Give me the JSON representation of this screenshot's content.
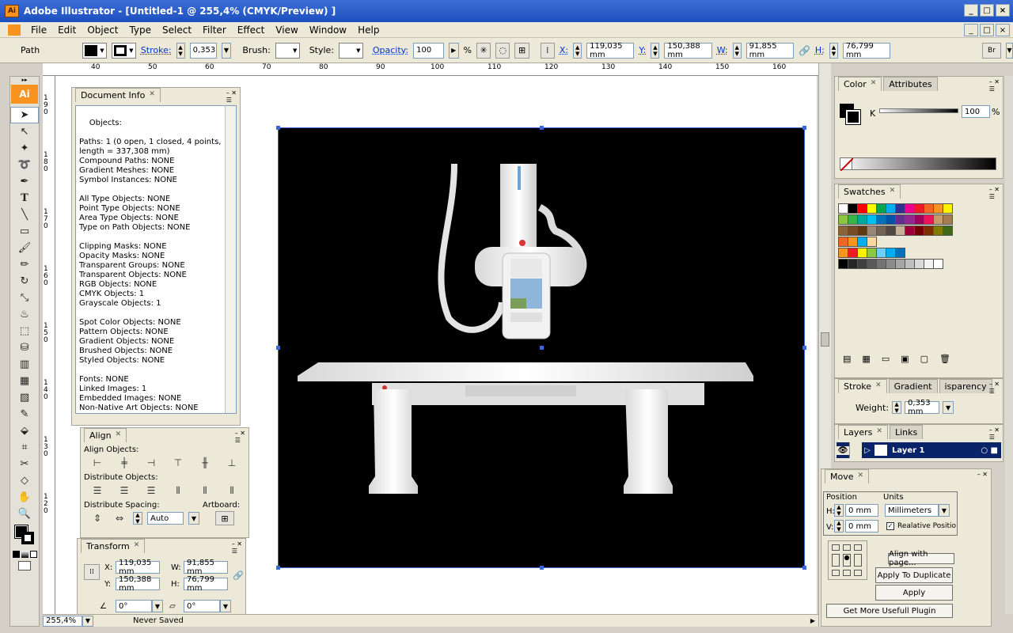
{
  "window": {
    "app_badge": "Ai",
    "title": "Adobe Illustrator - [Untitled-1 @ 255,4% (CMYK/Preview) ]",
    "min": "_",
    "max": "□",
    "close": "×"
  },
  "menu": [
    "File",
    "Edit",
    "Object",
    "Type",
    "Select",
    "Filter",
    "Effect",
    "View",
    "Window",
    "Help"
  ],
  "control": {
    "selection": "Path",
    "stroke_label": "Stroke:",
    "stroke_value": "0,353",
    "brush_label": "Brush:",
    "style_label": "Style:",
    "opacity_label": "Opacity:",
    "opacity_value": "100",
    "opacity_unit": "%",
    "x_label": "X:",
    "x_value": "119,035 mm",
    "y_label": "Y:",
    "y_value": "150,388 mm",
    "w_label": "W:",
    "w_value": "91,855 mm",
    "h_label": "H:",
    "h_value": "76,799 mm",
    "br_label": "Br"
  },
  "ruler": {
    "h_ticks": [
      "40",
      "50",
      "60",
      "70",
      "80",
      "90",
      "100",
      "110",
      "120",
      "130",
      "140",
      "150",
      "160"
    ],
    "v_ticks": [
      "1\n9\n0",
      "1\n8\n0",
      "1\n7\n0",
      "1\n6\n0",
      "1\n5\n0",
      "1\n4\n0",
      "1\n3\n0",
      "1\n2\n0"
    ]
  },
  "document_info": {
    "tab": "Document Info",
    "body": "Objects:\n\nPaths: 1 (0 open, 1 closed, 4 points,\nlength = 337,308 mm)\nCompound Paths: NONE\nGradient Meshes: NONE\nSymbol Instances: NONE\n\nAll Type Objects: NONE\nPoint Type Objects: NONE\nArea Type Objects: NONE\nType on Path Objects: NONE\n\nClipping Masks: NONE\nOpacity Masks: NONE\nTransparent Groups: NONE\nTransparent Objects: NONE\nRGB Objects: NONE\nCMYK Objects: 1\nGrayscale Objects: 1\n\nSpot Color Objects: NONE\nPattern Objects: NONE\nGradient Objects: NONE\nBrushed Objects: NONE\nStyled Objects: NONE\n\nFonts: NONE\nLinked Images: 1\nEmbedded Images: NONE\nNon-Native Art Objects: NONE"
  },
  "align": {
    "tab": "Align",
    "align_objects": "Align Objects:",
    "distribute_objects": "Distribute Objects:",
    "distribute_spacing": "Distribute Spacing:",
    "artboard": "Artboard:",
    "auto": "Auto"
  },
  "transform": {
    "tab": "Transform",
    "x_label": "X:",
    "x_value": "119,035 mm",
    "y_label": "Y:",
    "y_value": "150,388 mm",
    "w_label": "W:",
    "w_value": "91,855 mm",
    "h_label": "H:",
    "h_value": "76,799 mm",
    "angle_value": "0°",
    "shear_value": "0°"
  },
  "color_panel": {
    "tab_color": "Color",
    "tab_attributes": "Attributes",
    "k_label": "K",
    "k_value": "100",
    "k_unit": "%"
  },
  "swatches": {
    "tab": "Swatches",
    "row1": [
      "#ffffff",
      "#000000",
      "#ff0000",
      "#ffff00",
      "#00a651",
      "#00aeef",
      "#2e3192",
      "#ec008c",
      "#ed1c24",
      "#f26522",
      "#f7941d",
      "#fff200"
    ],
    "row2": [
      "#8dc63f",
      "#39b54a",
      "#00a99d",
      "#00bff3",
      "#0072bc",
      "#0054a6",
      "#662d91",
      "#92278f",
      "#9e005d",
      "#ed145b",
      "#c69c6d",
      "#a67c52"
    ],
    "row3": [
      "#8c6239",
      "#754c24",
      "#603913",
      "#998675",
      "#736357",
      "#534741",
      "#c7b299",
      "#9e0039",
      "#790000",
      "#7b2e00",
      "#827b00",
      "#406618"
    ],
    "row4": [
      "#f26522",
      "#f7941d",
      "#00aeef",
      "#ffd7a3"
    ],
    "row5": [
      "#f7941d",
      "#ed1c24",
      "#fff200",
      "#8dc63f",
      "#6dcff6",
      "#00aeef",
      "#0072bc"
    ],
    "row6": [
      "#000000",
      "#262626",
      "#404040",
      "#595959",
      "#737373",
      "#8c8c8c",
      "#a6a6a6",
      "#bfbfbf",
      "#d9d9d9",
      "#f2f2f2",
      "#ffffff"
    ]
  },
  "stroke_panel": {
    "tab_stroke": "Stroke",
    "tab_gradient": "Gradient",
    "tab_transparency": "isparency",
    "weight_label": "Weight:",
    "weight_value": "0,353 mm"
  },
  "layers": {
    "tab_layers": "Layers",
    "tab_links": "Links",
    "layer_name": "Layer 1"
  },
  "move": {
    "tab": "Move",
    "position_label": "Position",
    "units_label": "Units",
    "h_label": "H:",
    "h_value": "0 mm",
    "v_label": "V:",
    "v_value": "0 mm",
    "units_value": "Millimeters",
    "relative_label": "Realative Positio",
    "align_with_page": "Align with page...",
    "apply_duplicate": "Apply To Duplicate",
    "apply": "Apply",
    "get_more": "Get More Usefull Plugin"
  },
  "status": {
    "zoom": "255,4%",
    "state": "Never Saved"
  }
}
